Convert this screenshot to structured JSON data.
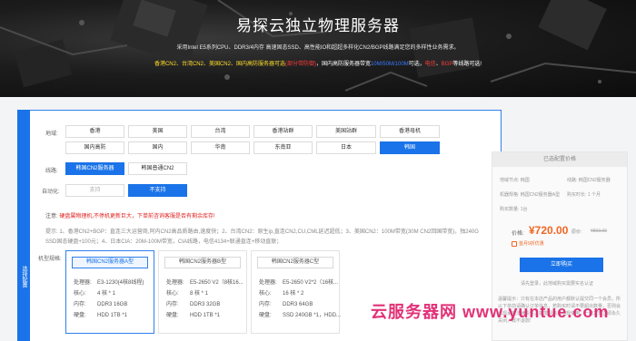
{
  "hero": {
    "title": "易探云独立物理服务器",
    "desc": "采用Intel E5系列CPU、DDR3/4内存 高速固态SSD、高性能IO和超超多样化CN2/BGP线路满足您的多样性业务需求。",
    "regions": [
      {
        "text": "香港CN2、台湾CN2、美国CN2、国内高防服务器可选",
        "color": "yellow"
      },
      {
        "text": "(部分带防御)",
        "color": "red"
      },
      {
        "text": "，国内高防服务器带宽",
        "color": "white"
      },
      {
        "text": "10M/50M/100M",
        "color": "blue"
      },
      {
        "text": "可选，",
        "color": "white"
      },
      {
        "text": "电信",
        "color": "red"
      },
      {
        "text": "、",
        "color": "white"
      },
      {
        "text": "BGP",
        "color": "red"
      },
      {
        "text": "等线路可选!",
        "color": "white"
      }
    ]
  },
  "form": {
    "side_label": "选择配置",
    "region_label": "地域:",
    "regions_row1": [
      "香港",
      "美国",
      "台湾",
      "香港站群",
      "美国站群",
      "香港母机"
    ],
    "regions_row2": [
      "国内高防",
      "国内",
      "华南",
      "东南亚",
      "日本",
      "韩国"
    ],
    "line_label": "线路:",
    "lines": [
      "韩国CN2服务器",
      "韩国普通CN2"
    ],
    "auto_label": "自动化:",
    "auto_options": [
      "支持",
      "不支持"
    ],
    "notice_prefix": "注意:",
    "notice_text": "硬盘属物理机,不停机更新巨大，下单前咨询客服是否有剩余库存!",
    "tips_label": "提示:",
    "tips_text": "1、香港CN2+BGP：直连三大运营商,阿内CN2高品质路由,速度快；2、台湾CN2：原生ip,直连CN2,CU,CML延迟超低；3、美国CN2：100M带宽(30M CN2回国带宽)，独240G SSD固态硬盘+100元；4、日本CIA：20M-100M带宽，CIA线路，电信4134+联通直连+移动直联；",
    "model_label": "机型规格:"
  },
  "configs": [
    {
      "name": "韩国CN2服务器A型",
      "cpu": "E3-1230(4核8线程)",
      "cores": "4 核 * 1",
      "ram": "DDR3 16GB",
      "disk": "HDD 1TB *1"
    },
    {
      "name": "韩国CN2服务器B型",
      "cpu": "E5-2650 V2（8核16...",
      "cores": "8 核 * 1",
      "ram": "DDR3 32GB",
      "disk": "HDD 1TB *1"
    },
    {
      "name": "韩国CN2服务器C型",
      "cpu": "E5-2650 V2*2（16核...",
      "cores": "16 核 * 2",
      "ram": "DDR3 64GB",
      "disk": "SSD 240GB *1，HDD..."
    }
  ],
  "spec_labels": {
    "cpu": "处理器:",
    "cores": "核心:",
    "ram": "内存:",
    "disk": "硬盘:"
  },
  "summary": {
    "title": "已选配置价格",
    "rows": [
      {
        "k": "地域节点:",
        "v": "韩国",
        "k2": "线路:",
        "v2": "韩国CN2服务器"
      },
      {
        "k": "机器规格:",
        "v": "韩国CN2服务器A型",
        "k2": "购买时长:",
        "v2": "1 个月"
      },
      {
        "k": "购买数量:",
        "v": "1台",
        "k2": "",
        "v2": ""
      }
    ],
    "price_label": "价格:",
    "price": "¥720.00",
    "old_label": "原价:",
    "old_price": "¥800.00",
    "coupon": "首月9折优惠",
    "buy": "立即购买",
    "note": "请先登录，此地域购买需要实名认证",
    "warm": "温馨提示：只有在本店产品的用户都默认提交同一个会员，所以下单前请确认订单信息，若购买时请不要超出数量，否则会出现承担法律责任。如发现违法违规使用，一经发现立即永久关闭，概不退款!"
  },
  "watermark": "云服务器网 www.yuntue.com"
}
